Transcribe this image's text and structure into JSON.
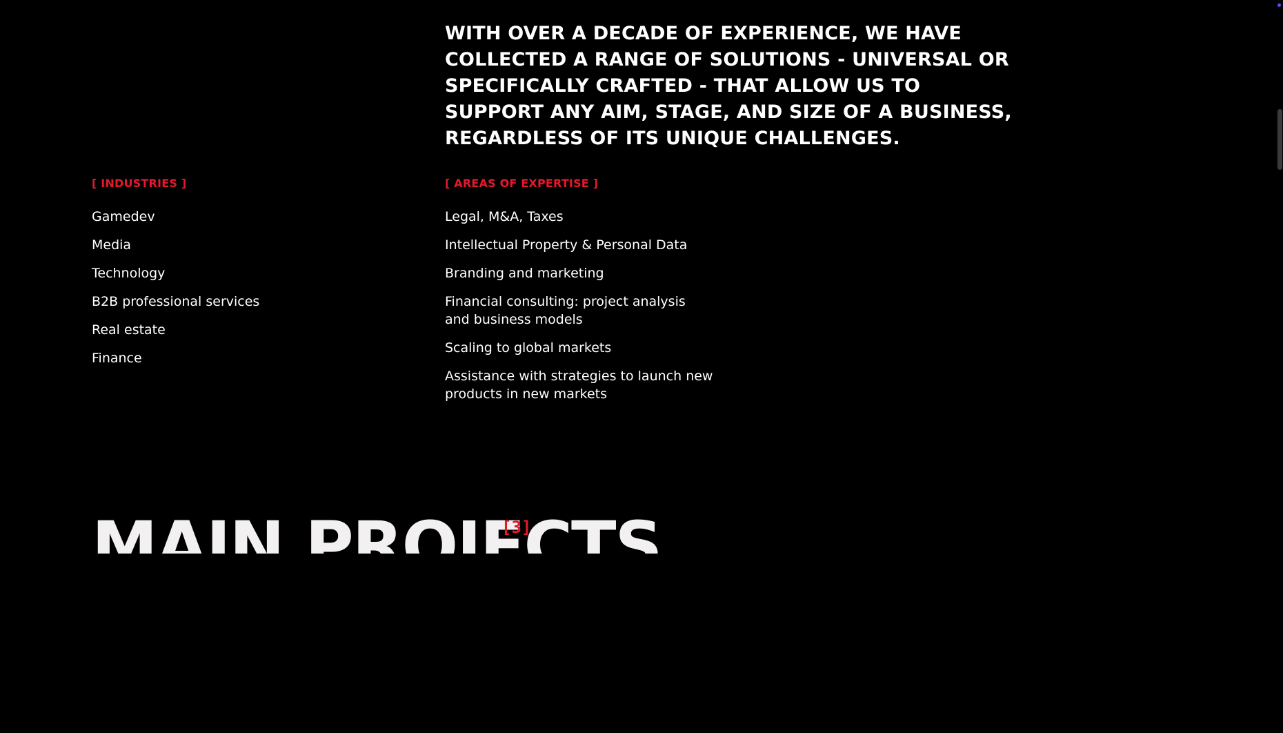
{
  "intro": {
    "text": "WITH OVER A DECADE OF EXPERIENCE, WE HAVE COLLECTED A RANGE OF SOLUTIONS - UNIVERSAL OR SPECIFICALLY CRAFTED - THAT ALLOW US TO SUPPORT ANY AIM, STAGE, AND SIZE OF A BUSINESS, REGARDLESS OF ITS UNIQUE CHALLENGES."
  },
  "industries": {
    "label": "[ INDUSTRIES ]",
    "items": [
      "Gamedev",
      "Media",
      "Technology",
      "B2B professional services",
      "Real estate",
      "Finance"
    ]
  },
  "expertise": {
    "label": "[ AREAS OF EXPERTISE ]",
    "items": [
      "Legal, M&A, Taxes",
      "Intellectual Property & Personal Data",
      "Branding and marketing",
      "Financial consulting: project analysis and business models",
      "Scaling to global markets",
      "Assistance with strategies to launch new products in new markets"
    ]
  },
  "projects": {
    "title": "MAIN PROJECTS",
    "count": "[3]"
  },
  "colors": {
    "background": "#000000",
    "text": "#ffffff",
    "accent": "#e5182c"
  }
}
